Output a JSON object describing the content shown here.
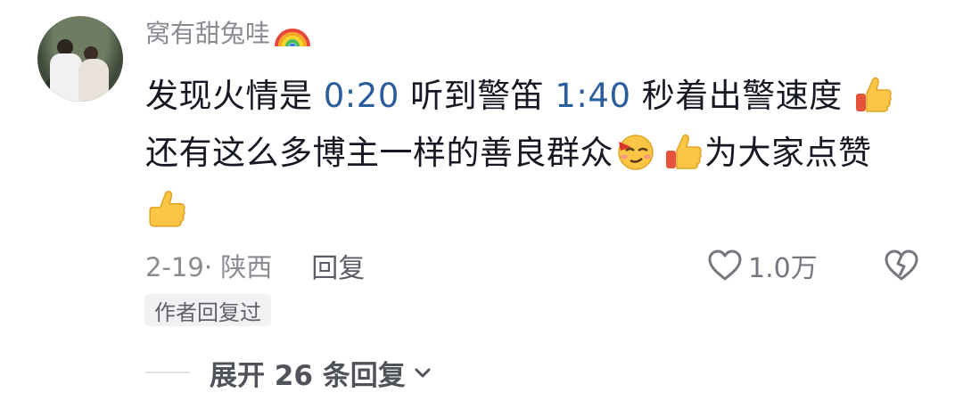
{
  "comment": {
    "username": "窝有甜兔哇",
    "text": {
      "part1": "发现火情是 ",
      "time1": "0:20",
      "part2": " 听到警笛 ",
      "time2": "1:40",
      "part3": " 秒着出警速度",
      "part4": "还有这么多博主一样的善良群众",
      "part5": "为大家点赞"
    },
    "emojis": [
      "rainbow-icon",
      "thumbs-up-icon",
      "smirk-wink-icon",
      "thumbs-up-icon",
      "thumbs-up-icon"
    ],
    "date_location": "2-19· 陕西",
    "reply_label": "回复",
    "like_count": "1.0万",
    "author_replied_tag": "作者回复过"
  },
  "replies": {
    "expand_label": "展开 26 条回复"
  },
  "colors": {
    "text": "#161823",
    "muted": "#8a8b91",
    "timestamp_link": "#2b5d9c",
    "tag_bg": "#f2f2f4"
  }
}
